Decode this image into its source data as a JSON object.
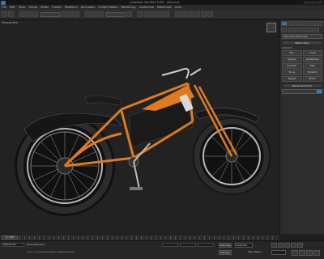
{
  "window": {
    "title": "Autodesk 3ds Max 2009 - bike.max"
  },
  "menu": [
    "File",
    "Edit",
    "Tools",
    "Group",
    "Views",
    "Create",
    "Modifiers",
    "Animation",
    "Graph Editors",
    "Rendering",
    "Customize",
    "MAXScript",
    "Help"
  ],
  "viewport": {
    "label": "Perspective"
  },
  "command_panel": {
    "category": "Standard Primitives",
    "object_type_header": "Object Type",
    "autogrid": "AutoGrid",
    "object_buttons": [
      "Box",
      "Cone",
      "Sphere",
      "GeoSphere",
      "Cylinder",
      "Tube",
      "Torus",
      "Pyramid",
      "Teapot",
      "Plane"
    ],
    "name_color_header": "Name and Color"
  },
  "timeline": {
    "slider": "0 / 100"
  },
  "status": {
    "maxscript": "MAXScript.",
    "selection": "None Selected",
    "prompt": "Click or click-and-drag to select objects",
    "autokey": "Auto Key",
    "setkey": "Set Key",
    "selected_mode": "Selected",
    "key_filters": "Key Filters..."
  },
  "colors": {
    "frame_orange": "#e07a1f",
    "accent_blue": "#2a7bd5"
  }
}
